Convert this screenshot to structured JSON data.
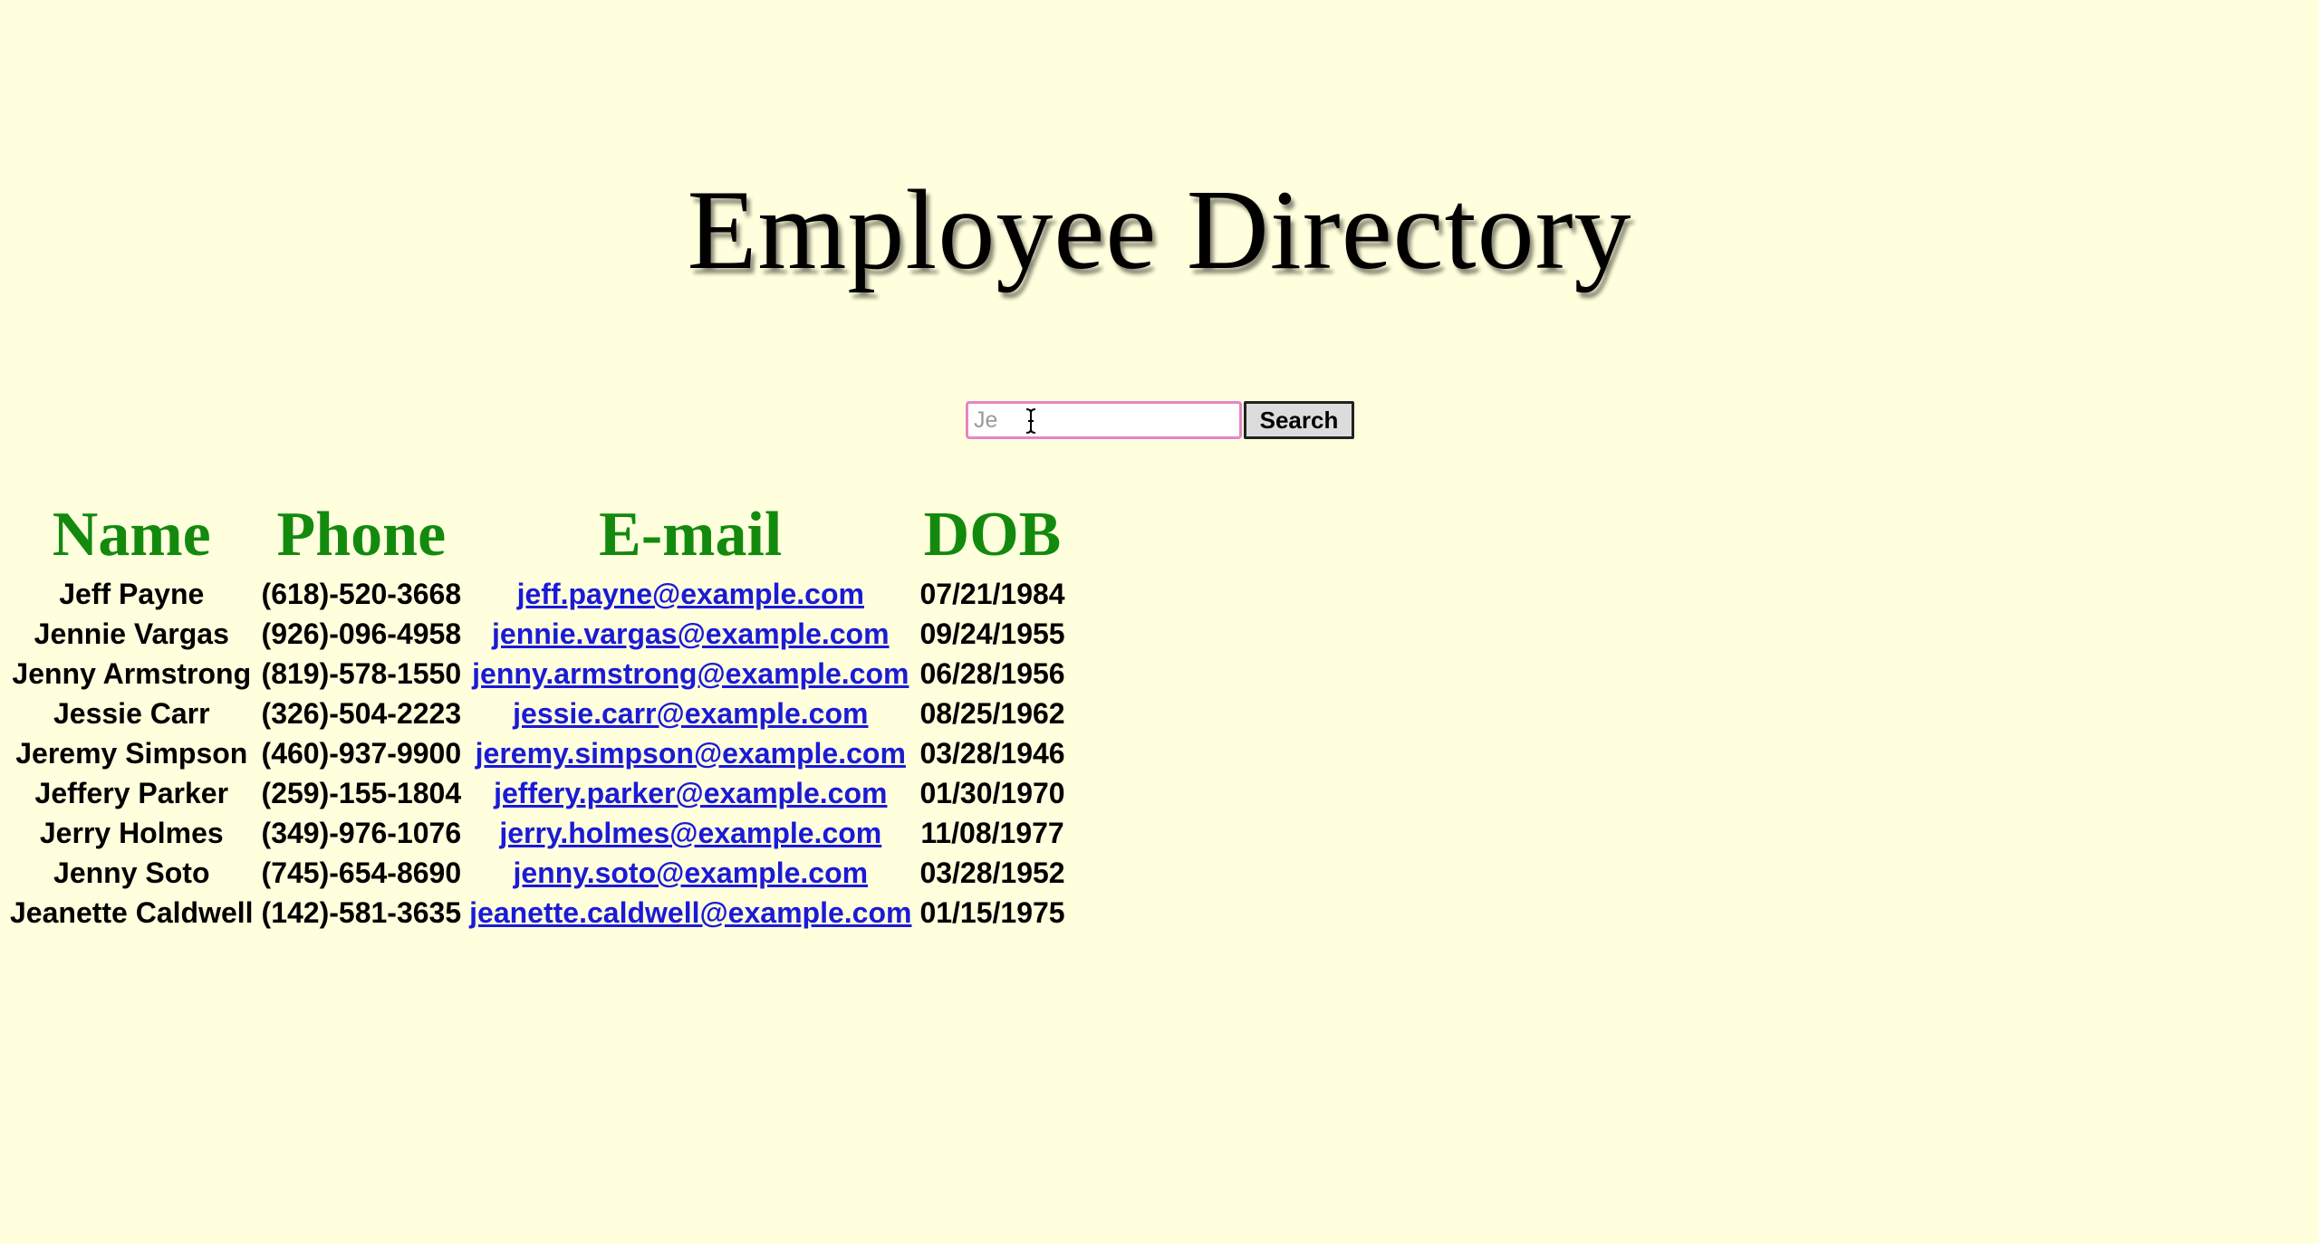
{
  "page": {
    "title": "Employee Directory",
    "background_color": "#ffffdd"
  },
  "search": {
    "placeholder": "Je",
    "value": "",
    "button_label": "Search",
    "focus_border_color": "#e685c8"
  },
  "table": {
    "header_color": "#138a0e",
    "link_color": "#1a1ad6",
    "columns": [
      "Name",
      "Phone",
      "E-mail",
      "DOB"
    ],
    "rows": [
      {
        "name": "Jeff Payne",
        "phone": "(618)-520-3668",
        "email": "jeff.payne@example.com",
        "dob": "07/21/1984"
      },
      {
        "name": "Jennie Vargas",
        "phone": "(926)-096-4958",
        "email": "jennie.vargas@example.com",
        "dob": "09/24/1955"
      },
      {
        "name": "Jenny Armstrong",
        "phone": "(819)-578-1550",
        "email": "jenny.armstrong@example.com",
        "dob": "06/28/1956"
      },
      {
        "name": "Jessie Carr",
        "phone": "(326)-504-2223",
        "email": "jessie.carr@example.com",
        "dob": "08/25/1962"
      },
      {
        "name": "Jeremy Simpson",
        "phone": "(460)-937-9900",
        "email": "jeremy.simpson@example.com",
        "dob": "03/28/1946"
      },
      {
        "name": "Jeffery Parker",
        "phone": "(259)-155-1804",
        "email": "jeffery.parker@example.com",
        "dob": "01/30/1970"
      },
      {
        "name": "Jerry Holmes",
        "phone": "(349)-976-1076",
        "email": "jerry.holmes@example.com",
        "dob": "11/08/1977"
      },
      {
        "name": "Jenny Soto",
        "phone": "(745)-654-8690",
        "email": "jenny.soto@example.com",
        "dob": "03/28/1952"
      },
      {
        "name": "Jeanette Caldwell",
        "phone": "(142)-581-3635",
        "email": "jeanette.caldwell@example.com",
        "dob": "01/15/1975"
      }
    ]
  },
  "icons": {
    "cursor": "text-cursor-icon"
  }
}
